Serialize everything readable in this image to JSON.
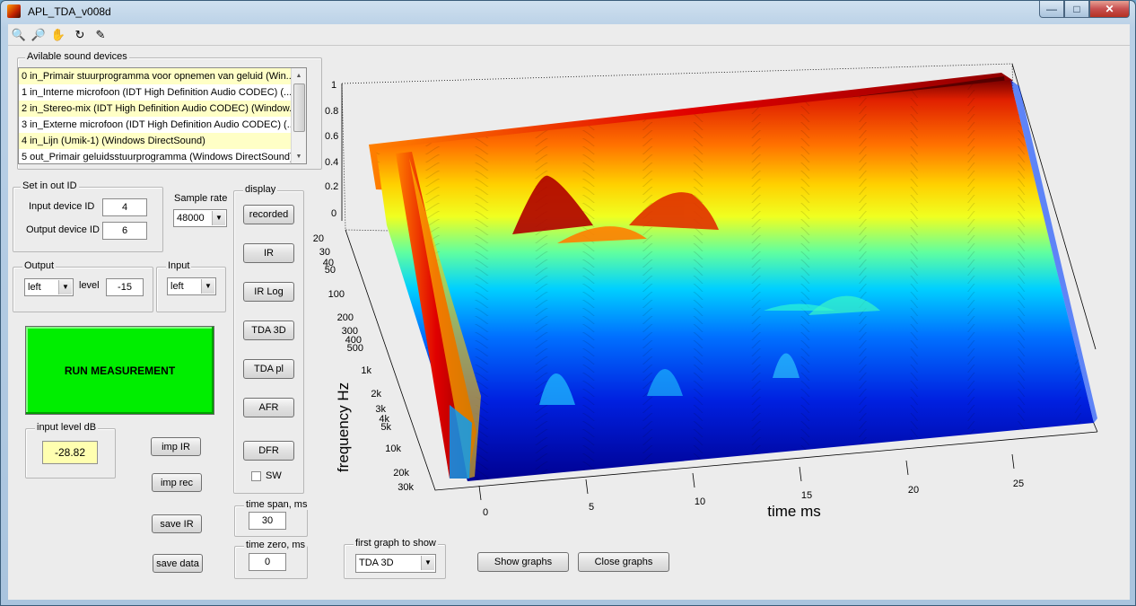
{
  "window": {
    "title": "APL_TDA_v008d"
  },
  "titlebar": {
    "min_glyph": "—",
    "max_glyph": "□",
    "close_glyph": "✕"
  },
  "toolbar": [
    {
      "name": "zoom-in-icon",
      "glyph": "🔍"
    },
    {
      "name": "zoom-out-icon",
      "glyph": "🔎"
    },
    {
      "name": "pan-hand-icon",
      "glyph": "✋"
    },
    {
      "name": "rotate-3d-icon",
      "glyph": "↻"
    },
    {
      "name": "data-cursor-icon",
      "glyph": "✎"
    }
  ],
  "devices": {
    "legend": "Avilable sound devices",
    "items": [
      "0 in_Primair stuurprogramma voor opnemen van geluid (Win...",
      "1 in_Interne microfoon (IDT High Definition Audio CODEC) (...",
      "2 in_Stereo-mix (IDT High Definition Audio CODEC) (Window...",
      "3 in_Externe microfoon (IDT High Definition Audio CODEC) (...",
      "4 in_Lijn (Umik-1) (Windows DirectSound)",
      "5 out_Primair geluidsstuurprogramma (Windows DirectSound)"
    ],
    "selected": [
      0,
      2,
      4
    ]
  },
  "set_io": {
    "legend": "Set in out ID",
    "input_label": "Input device ID",
    "input_value": "4",
    "output_label": "Output device ID",
    "output_value": "6"
  },
  "sample_rate": {
    "label": "Sample rate",
    "value": "48000"
  },
  "output": {
    "legend": "Output",
    "channel": "left",
    "level_label": "level",
    "level_value": "-15"
  },
  "input": {
    "legend": "Input",
    "channel": "left"
  },
  "run_button": "RUN MEASUREMENT",
  "input_level": {
    "legend": "input level dB",
    "value": "-28.82"
  },
  "buttons_left": {
    "imp_ir": "imp IR",
    "imp_rec": "imp rec",
    "save_ir": "save IR",
    "save_data": "save data"
  },
  "display": {
    "legend": "display",
    "buttons": [
      "recorded",
      "IR",
      "IR Log",
      "TDA 3D",
      "TDA pl",
      "AFR",
      "DFR"
    ],
    "sw_label": "SW",
    "sw_checked": false
  },
  "time_span": {
    "legend": "time span, ms",
    "value": "30"
  },
  "time_zero": {
    "legend": "time zero, ms",
    "value": "0"
  },
  "first_graph": {
    "legend": "first graph to show",
    "value": "TDA 3D"
  },
  "show_graphs": "Show graphs",
  "close_graphs": "Close graphs",
  "plot": {
    "z_ticks": [
      "1",
      "0.8",
      "0.6",
      "0.4",
      "0.2",
      "0"
    ],
    "freq_ticks": [
      "20",
      "30",
      "40",
      "50",
      "100",
      "200",
      "300",
      "400",
      "500",
      "1k",
      "2k",
      "3k",
      "4k",
      "5k",
      "10k",
      "20k",
      "30k"
    ],
    "time_ticks": [
      "0",
      "5",
      "10",
      "15",
      "20",
      "25"
    ],
    "ylabel": "frequency   Hz",
    "xlabel": "time   ms"
  },
  "colors": {
    "run": "#00ee00",
    "level_bg": "#ffffb0",
    "list_sel": "#ffffc6"
  }
}
